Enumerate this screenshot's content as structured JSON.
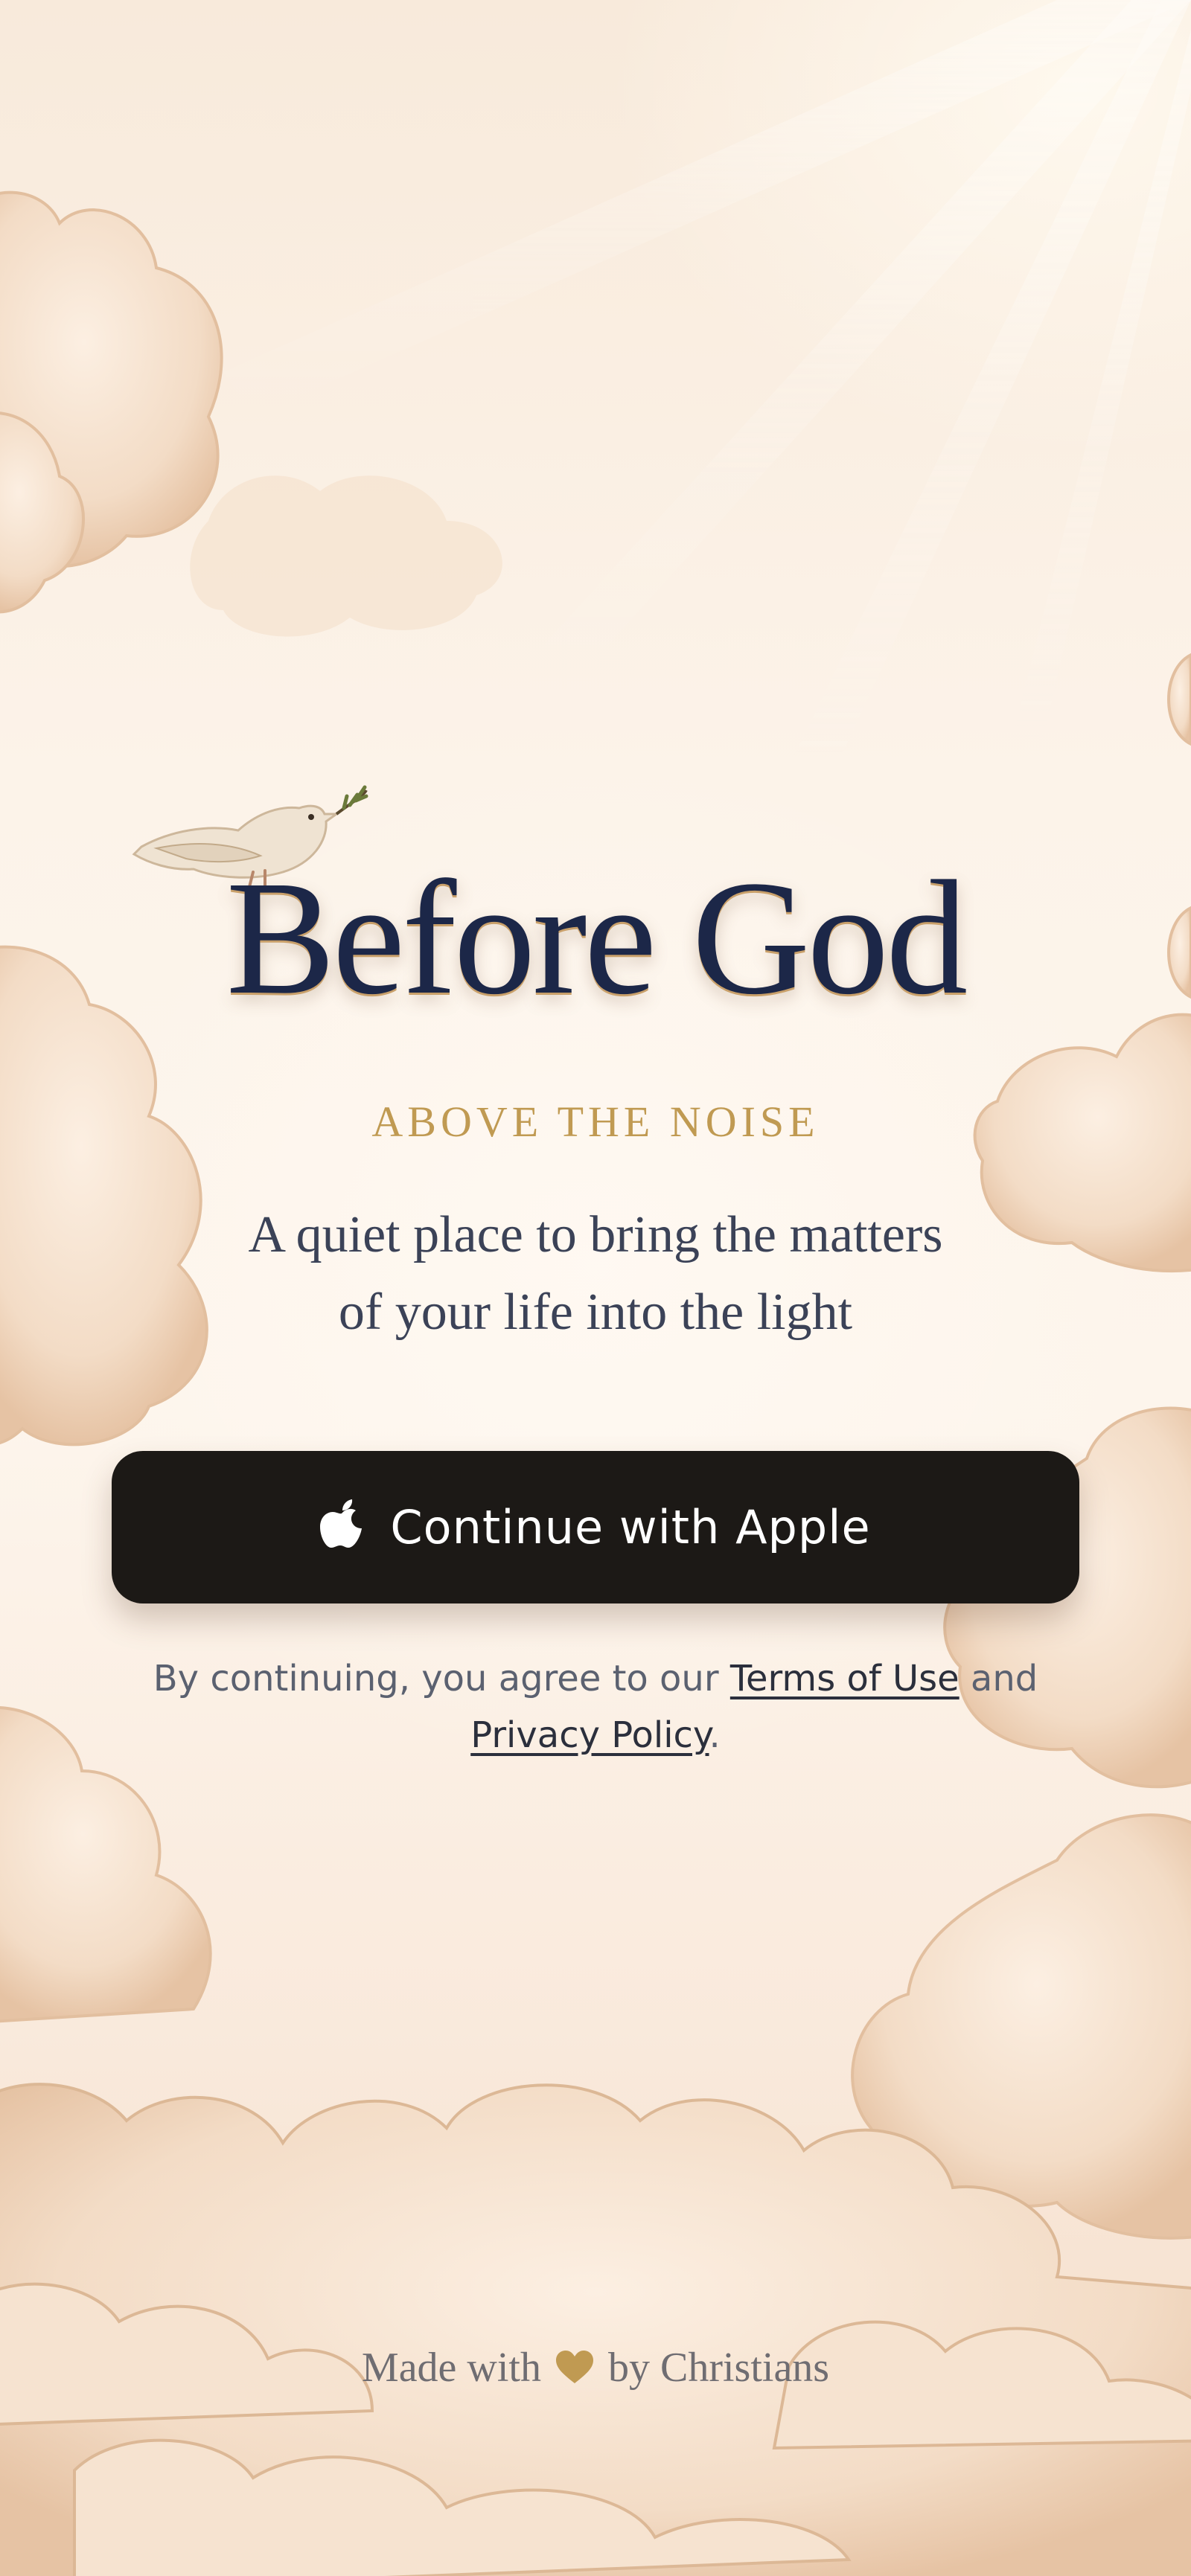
{
  "app": {
    "title": "Before God",
    "tagline": "ABOVE THE NOISE",
    "subtitle_line1": "A quiet place to bring the matters",
    "subtitle_line2": "of your life into the light"
  },
  "auth": {
    "apple_button_label": "Continue with Apple",
    "apple_icon": "apple-logo-icon"
  },
  "legal": {
    "prefix": "By continuing, you agree to our",
    "terms_label": "Terms of Use",
    "conjunction": "and",
    "privacy_label": "Privacy Policy",
    "suffix": "."
  },
  "footer": {
    "made_with": "Made with",
    "heart_icon": "heart-icon",
    "by": "by Christians"
  },
  "colors": {
    "title": "#1c2748",
    "tagline": "#c09a52",
    "button_bg": "#1c1916",
    "heart": "#c09a52"
  }
}
